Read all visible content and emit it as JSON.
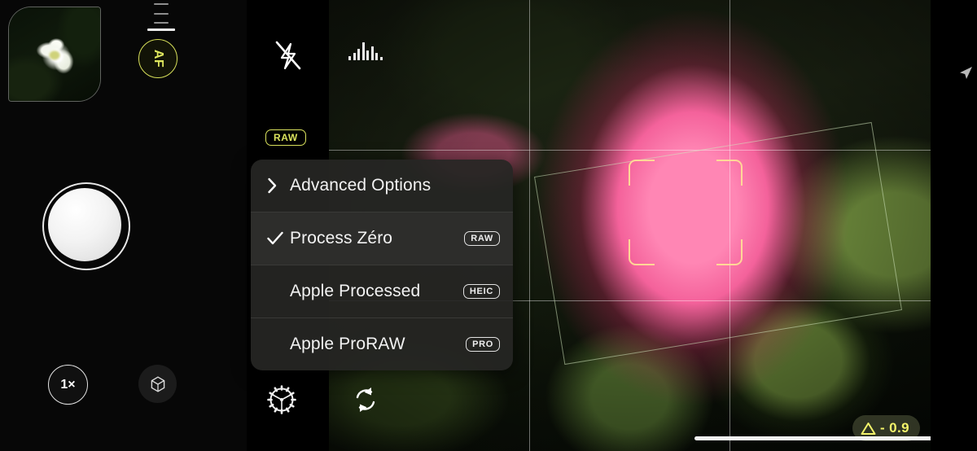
{
  "app": {
    "name": "pro-camera-viewfinder",
    "orientation": "landscape"
  },
  "left_panel": {
    "thumbnail": {
      "name": "last-photo-thumbnail",
      "alt": "white rose photo"
    },
    "focus_mode_button": {
      "label": "AF"
    },
    "shutter_button": {
      "label": ""
    },
    "zoom_button": {
      "label": "1×"
    },
    "lens_button": {
      "icon": "aperture-hexagon-icon"
    },
    "tick_scale": {
      "ticks": 3
    }
  },
  "side_column": {
    "flash_button": {
      "icon": "flash-off-icon",
      "state": "off"
    },
    "raw_badge": {
      "label": "RAW",
      "color": "#dbe35d"
    },
    "settings_button": {
      "icon": "gear-icon"
    }
  },
  "viewfinder": {
    "histogram": {
      "icon": "histogram-icon",
      "bars": [
        5,
        9,
        14,
        22,
        12,
        17,
        9,
        4
      ]
    },
    "flip_camera_button": {
      "icon": "camera-flip-icon"
    },
    "focus_box": {
      "name": "focus-bracket"
    },
    "level_indicator": {
      "name": "horizon-level-rect",
      "rotation_deg": -9.2
    },
    "grid": {
      "enabled": true,
      "type": "rule-of-thirds"
    },
    "exposure_compensation": {
      "icon": "triangle-icon",
      "value": "- 0.9",
      "color": "#f3f36a"
    },
    "nav_arrow": {
      "icon": "location-arrow-icon"
    },
    "home_indicator": {
      "name": "home-indicator"
    }
  },
  "menu": {
    "name": "processing-mode-menu",
    "rows": [
      {
        "label": "Advanced Options",
        "lead": "chevron-right-icon",
        "badge": "",
        "checked": false,
        "highlight": false
      },
      {
        "label": "Process Zéro",
        "lead": "check-icon",
        "badge": "RAW",
        "checked": true,
        "highlight": true
      },
      {
        "label": "Apple Processed",
        "lead": "",
        "badge": "HEIC",
        "checked": false,
        "highlight": false
      },
      {
        "label": "Apple ProRAW",
        "lead": "",
        "badge": "PRO",
        "checked": false,
        "highlight": false
      }
    ]
  }
}
